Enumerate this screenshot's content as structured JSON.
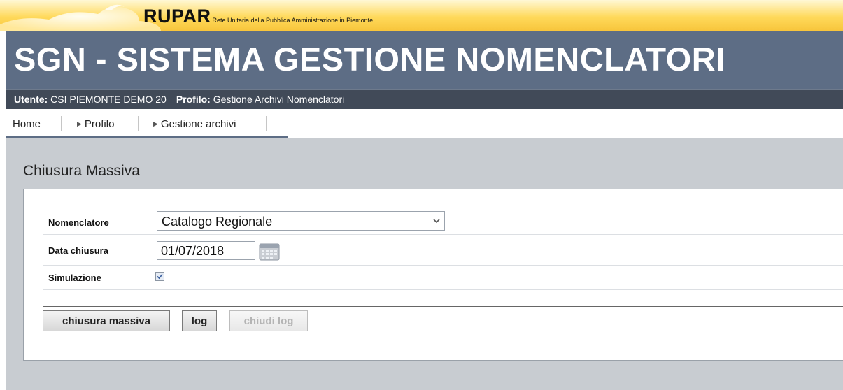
{
  "banner": {
    "brand": "RUPAR",
    "subtitle": "Rete Unitaria della Pubblica Amministrazione in Piemonte"
  },
  "header": {
    "title": "SGN - SISTEMA GESTIONE NOMENCLATORI"
  },
  "userbar": {
    "user_label": "Utente:",
    "user_value": "CSI PIEMONTE DEMO 20",
    "profile_label": "Profilo:",
    "profile_value": "Gestione Archivi Nomenclatori"
  },
  "nav": {
    "items": [
      {
        "label": "Home"
      },
      {
        "label": "Profilo"
      },
      {
        "label": "Gestione archivi"
      }
    ]
  },
  "page": {
    "title": "Chiusura Massiva"
  },
  "form": {
    "nomenclatore": {
      "label": "Nomenclatore",
      "value": "Catalogo Regionale"
    },
    "data_chiusura": {
      "label": "Data chiusura",
      "value": "01/07/2018"
    },
    "simulazione": {
      "label": "Simulazione",
      "checked": true
    }
  },
  "buttons": {
    "chiusura_massiva": "chiusura massiva",
    "log": "log",
    "chiudi_log": "chiudi log"
  },
  "colors": {
    "banner_yellow": "#f7c43a",
    "header_bg": "#5d6d85",
    "userbar_bg": "#414a58",
    "content_bg": "#c8ccd1"
  }
}
